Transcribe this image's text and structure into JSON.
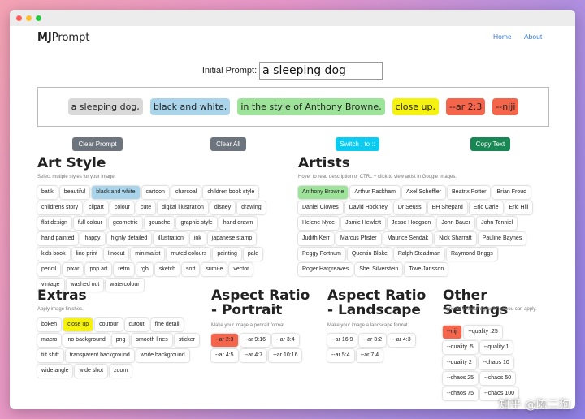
{
  "brand": {
    "bold": "MJ",
    "rest": "Prompt"
  },
  "nav": {
    "home": "Home",
    "about": "About"
  },
  "initial_prompt": {
    "label": "Initial Prompt:",
    "value": "a sleeping dog"
  },
  "prompt_tokens": [
    {
      "text": "a sleeping dog,",
      "color": "#d9d9d9"
    },
    {
      "text": "black and white,",
      "color": "#a9d4ea"
    },
    {
      "text": "in the style of Anthony Browne,",
      "color": "#9ee39a"
    },
    {
      "text": "close up,",
      "color": "#f6f20f"
    },
    {
      "text": "--ar 2:3",
      "color": "#f5654b"
    },
    {
      "text": "--niji",
      "color": "#f5654b"
    }
  ],
  "buttons": {
    "clear_prompt": "Clear Prompt",
    "clear_all": "Clear All",
    "switch": "Switch , to ::",
    "copy": "Copy Text"
  },
  "colors": {
    "accent_blue": "#3a7bd5",
    "btn_gray": "#6c757d",
    "btn_cyan": "#0dcaf0",
    "btn_green": "#198754",
    "selected_blue": "#a9d4ea",
    "selected_green": "#9ee39a",
    "selected_yellow": "#f6f20f",
    "selected_red": "#f5654b"
  },
  "art_style": {
    "title": "Art Style",
    "desc": "Select mutiple styles for your image.",
    "items": [
      "batik",
      "beautiful",
      "black and white",
      "cartoon",
      "charcoal",
      "children book style",
      "childrens story",
      "clipart",
      "colour",
      "cute",
      "digital illustration",
      "disney",
      "drawing",
      "flat design",
      "full colour",
      "geometric",
      "gouache",
      "graphic style",
      "hand drawn",
      "hand painted",
      "happy",
      "highly detailed",
      "illustration",
      "ink",
      "japanese stamp",
      "kids book",
      "lino print",
      "linocut",
      "minimalist",
      "muted colours",
      "painting",
      "pale",
      "pencil",
      "pixar",
      "pop art",
      "retro",
      "rgb",
      "sketch",
      "soft",
      "sumi-e",
      "vector",
      "vintage",
      "washed out",
      "watercolour"
    ],
    "selected": "black and white"
  },
  "artists": {
    "title": "Artists",
    "desc": "Hover to read description or CTRL + click to view artist in Google Images.",
    "items": [
      "Anthony Browne",
      "Arthur Rackham",
      "Axel Scheffler",
      "Beatrix Potter",
      "Brian Froud",
      "Daniel Clowes",
      "David Hockney",
      "Dr Seuss",
      "EH Shepard",
      "Eric Carle",
      "Eric Hill",
      "Helene Nyce",
      "Jamie Hewlett",
      "Jesse Hodgson",
      "John Bauer",
      "John Tenniel",
      "Judith Kerr",
      "Marcus Pfister",
      "Maurice Sendak",
      "Nick Sharratt",
      "Pauline Baynes",
      "Peggy Fortnum",
      "Quentin Blake",
      "Ralph Steadman",
      "Raymond Briggs",
      "Roger Hargreaves",
      "Shel Silverstein",
      "Tove Jansson"
    ],
    "selected": "Anthony Browne"
  },
  "extras": {
    "title": "Extras",
    "desc": "Apply image finishes.",
    "items": [
      "bokeh",
      "close up",
      "coutour",
      "cutout",
      "fine detail",
      "macro",
      "no background",
      "png",
      "smooth lines",
      "sticker",
      "tilt shift",
      "transparent background",
      "white background",
      "wide angle",
      "wide shot",
      "zoom"
    ],
    "selected": "close up"
  },
  "aspect_portrait": {
    "title": "Aspect Ratio - Portrait",
    "desc": "Make your image a portrait format.",
    "items": [
      "--ar 2:3",
      "--ar 9:16",
      "--ar 3:4",
      "--ar 4:5",
      "--ar 4:7",
      "--ar 10:16"
    ],
    "selected": "--ar 2:3"
  },
  "aspect_landscape": {
    "title": "Aspect Ratio - Landscape",
    "desc": "Make your image a landscape format.",
    "items": [
      "--ar 16:9",
      "--ar 3:2",
      "--ar 4:3",
      "--ar 5:4",
      "--ar 7:4"
    ],
    "selected": ""
  },
  "other_settings": {
    "title": "Other Settings",
    "desc": "Optional Midjourney settings you can apply.",
    "items": [
      "--niji",
      "--quality .25",
      "--quality .5",
      "--quality 1",
      "--quality 2",
      "--chaos 10",
      "--chaos 25",
      "--chaos 50",
      "--chaos 75",
      "--chaos 100"
    ],
    "selected": "--niji"
  },
  "watermark": "知乎 @陈二狗"
}
